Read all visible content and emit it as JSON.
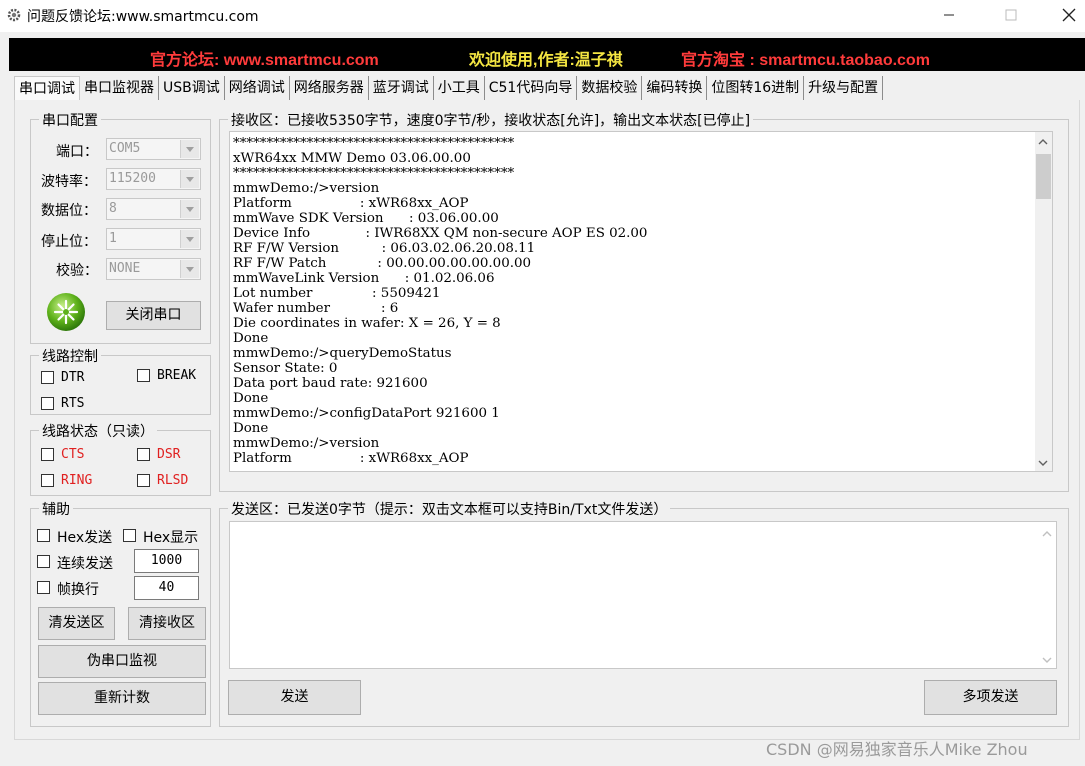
{
  "window": {
    "title": "问题反馈论坛:www.smartmcu.com",
    "icon": "gear-icon"
  },
  "banner": {
    "forum": "官方论坛: www.smartmcu.com",
    "welcome": "欢迎使用,作者:温子祺",
    "shop": "官方淘宝 : smartmcu.taobao.com",
    "colors": {
      "red": "#ff3b3b",
      "yellow": "#f5e642"
    }
  },
  "tabs": [
    "串口调试",
    "串口监视器",
    "USB调试",
    "网络调试",
    "网络服务器",
    "蓝牙调试",
    "小工具",
    "C51代码向导",
    "数据校验",
    "编码转换",
    "位图转16进制",
    "升级与配置"
  ],
  "serial_config": {
    "title": "串口配置",
    "port_label": "端口：",
    "port_value": "COM5",
    "baud_label": "波特率：",
    "baud_value": "115200",
    "data_label": "数据位：",
    "data_value": "8",
    "stop_label": "停止位：",
    "stop_value": "1",
    "parity_label": "校验：",
    "parity_value": "NONE",
    "close_button": "关闭串口"
  },
  "line_control": {
    "title": "线路控制",
    "dtr": "DTR",
    "break": "BREAK",
    "rts": "RTS"
  },
  "line_status": {
    "title": "线路状态（只读）",
    "cts": "CTS",
    "dsr": "DSR",
    "ring": "RING",
    "rlsd": "RLSD"
  },
  "aux": {
    "title": "辅助",
    "hex_send": "Hex发送",
    "hex_display": "Hex显示",
    "continuous_send": "连续发送",
    "interval_value": "1000",
    "frame_newline": "帧换行",
    "frame_value": "40",
    "clear_send": "清发送区",
    "clear_recv": "清接收区",
    "pseudo_monitor": "伪串口监视",
    "recount": "重新计数"
  },
  "receive": {
    "title": "接收区：已接收5350字节，速度0字节/秒，接收状态[允许]，输出文本状态[已停止]",
    "lines": [
      "******************************************",
      "xWR64xx MMW Demo 03.06.00.00",
      "******************************************",
      "mmwDemo:/>version",
      "Platform                : xWR68xx_AOP",
      "mmWave SDK Version      : 03.06.00.00",
      "Device Info             : IWR68XX QM non-secure AOP ES 02.00",
      "RF F/W Version          : 06.03.02.06.20.08.11",
      "RF F/W Patch            : 00.00.00.00.00.00.00",
      "mmWaveLink Version      : 01.02.06.06",
      "Lot number              : 5509421",
      "Wafer number            : 6",
      "Die coordinates in wafer: X = 26, Y = 8",
      "Done",
      "mmwDemo:/>queryDemoStatus",
      "Sensor State: 0",
      "Data port baud rate: 921600",
      "Done",
      "mmwDemo:/>configDataPort 921600 1",
      "Done",
      "mmwDemo:/>version",
      "Platform                : xWR68xx_AOP"
    ]
  },
  "send": {
    "title": "发送区：已发送0字节（提示：双击文本框可以支持Bin/Txt文件发送）",
    "send_button": "发送",
    "multi_send_button": "多项发送"
  },
  "watermark": "CSDN @网易独家音乐人Mike Zhou"
}
